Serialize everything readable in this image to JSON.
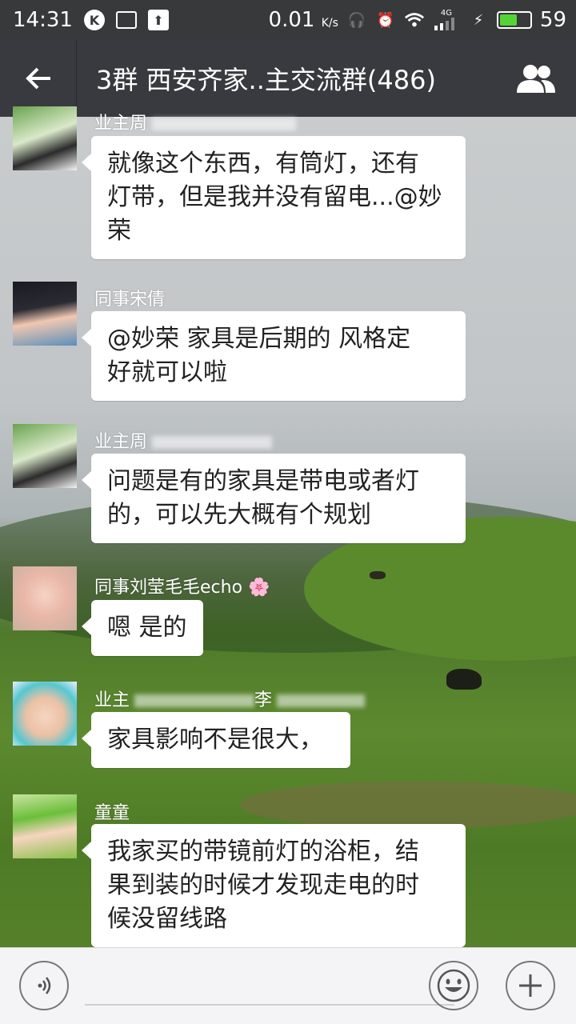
{
  "status_bar": {
    "time": "14:31",
    "k_icon": "K",
    "network_speed": "0.01",
    "network_unit": "K/s",
    "signal_label": "4G",
    "battery_level": 59,
    "battery_text": "59"
  },
  "header": {
    "back_icon": "back-arrow-icon",
    "title": "3群 西安齐家..主交流群(486)",
    "group_icon": "group-members-icon"
  },
  "messages": [
    {
      "sender": "业主周",
      "text_lines": [
        "就像这个东西，有筒灯，还有",
        "灯带，但是我并没有留电...@妙",
        "荣"
      ]
    },
    {
      "sender": "同事宋倩",
      "text_lines": [
        "@妙荣 家具是后期的   风格定",
        "好就可以啦"
      ]
    },
    {
      "sender": "业主周",
      "text_lines": [
        "问题是有的家具是带电或者灯",
        "的，可以先大概有个规划"
      ]
    },
    {
      "sender": "同事刘莹毛毛echo 🌸",
      "text_lines": [
        "嗯 是的"
      ]
    },
    {
      "sender": "业主",
      "sender_suffix": "李",
      "text_lines": [
        "家具影响不是很大，"
      ]
    },
    {
      "sender": "童童",
      "text_lines": [
        "我家买的带镜前灯的浴柜，结",
        "果到装的时候才发现走电的时",
        "候没留线路"
      ]
    }
  ],
  "input_bar": {
    "voice_icon": "voice-icon",
    "emoji_icon": "emoji-icon",
    "plus_icon": "plus-icon"
  }
}
